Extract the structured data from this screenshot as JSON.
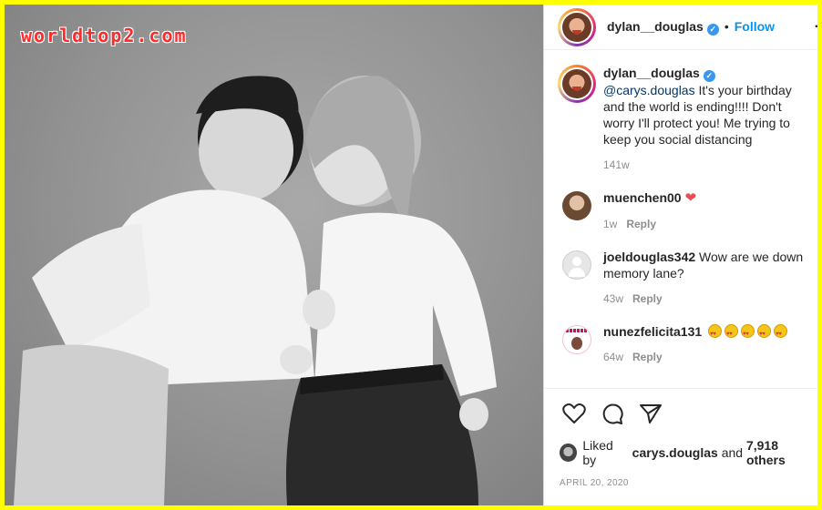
{
  "watermark": "worldtop2.com",
  "post_header": {
    "username": "dylan__douglas",
    "separator": "•",
    "follow_label": "Follow",
    "more_glyph": "·"
  },
  "caption": {
    "username": "dylan__douglas",
    "mention": "@carys.douglas",
    "text": " It's your birthday and the world is ending!!!! Don't worry I'll protect you! Me trying to keep you social distancing",
    "age": "141w"
  },
  "comments": [
    {
      "username": "muenchen00",
      "text": "",
      "emoji": "heart",
      "age": "1w",
      "reply_label": "Reply"
    },
    {
      "username": "joeldouglas342",
      "text": "Wow are we down memory lane?",
      "age": "43w",
      "reply_label": "Reply"
    },
    {
      "username": "nunezfelicita131",
      "text": "",
      "emoji": "heart-eyes-x5",
      "age": "64w",
      "reply_label": "Reply"
    }
  ],
  "likes": {
    "prefix": "Liked by",
    "user": "carys.douglas",
    "and": "and",
    "count": "7,918 others"
  },
  "date": "APRIL 20, 2020",
  "icons": [
    "heart-icon",
    "comment-icon",
    "share-icon",
    "bookmark-icon"
  ],
  "colors": {
    "border_yellow": "#ffff00",
    "watermark_red": "#ff2a2a",
    "follow_blue": "#0095f6",
    "verified_blue": "#3897f0",
    "heart_red": "#ed4956"
  }
}
